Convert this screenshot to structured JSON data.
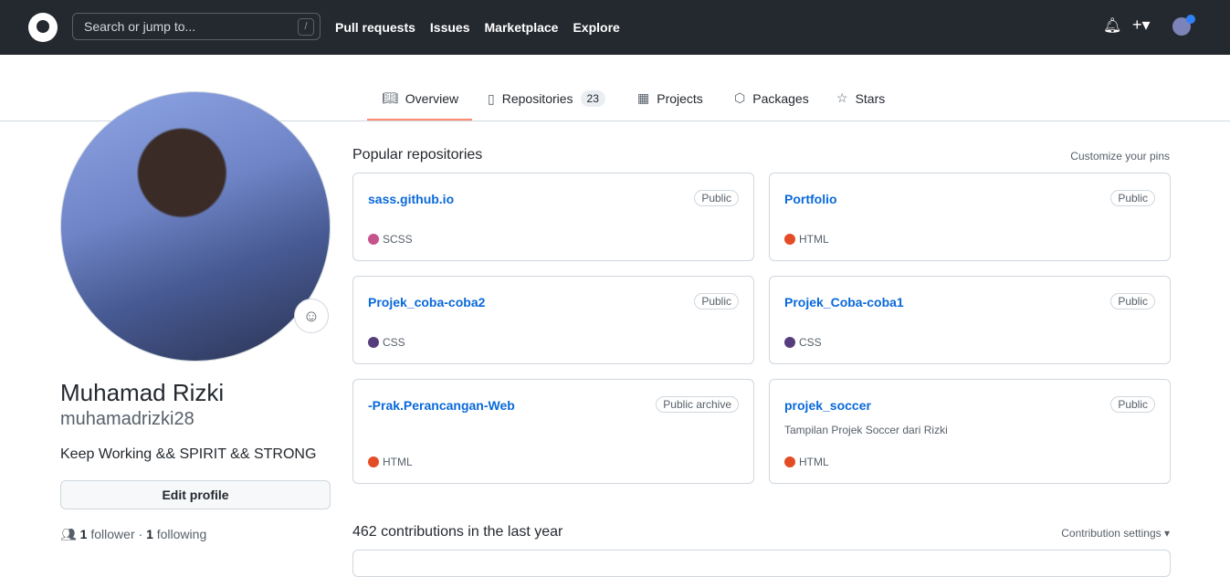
{
  "header": {
    "search_placeholder": "Search or jump to...",
    "slash": "/",
    "nav": [
      "Pull requests",
      "Issues",
      "Marketplace",
      "Explore"
    ]
  },
  "tabs": [
    {
      "label": "Overview"
    },
    {
      "label": "Repositories",
      "count": "23"
    },
    {
      "label": "Projects"
    },
    {
      "label": "Packages"
    },
    {
      "label": "Stars"
    }
  ],
  "profile": {
    "name": "Muhamad Rizki",
    "login": "muhamadrizki28",
    "bio": "Keep Working && SPIRIT && STRONG",
    "edit": "Edit profile",
    "followers": "1",
    "followers_label": "follower",
    "sep": "·",
    "following": "1",
    "following_label": "following"
  },
  "pinned": {
    "title": "Popular repositories",
    "customize": "Customize your pins",
    "repos": [
      {
        "name": "sass.github.io",
        "visibility": "Public",
        "desc": "",
        "lang": "SCSS",
        "color": "#c6538c"
      },
      {
        "name": "Portfolio",
        "visibility": "Public",
        "desc": "",
        "lang": "HTML",
        "color": "#e34c26"
      },
      {
        "name": "Projek_coba-coba2",
        "visibility": "Public",
        "desc": "",
        "lang": "CSS",
        "color": "#563d7c"
      },
      {
        "name": "Projek_Coba-coba1",
        "visibility": "Public",
        "desc": "",
        "lang": "CSS",
        "color": "#563d7c"
      },
      {
        "name": "-Prak.Perancangan-Web",
        "visibility": "Public archive",
        "desc": "",
        "lang": "HTML",
        "color": "#e34c26"
      },
      {
        "name": "projek_soccer",
        "visibility": "Public",
        "desc": "Tampilan Projek Soccer dari Rizki",
        "lang": "HTML",
        "color": "#e34c26"
      }
    ]
  },
  "contrib": {
    "title": "462 contributions in the last year",
    "settings": "Contribution settings ▾"
  }
}
